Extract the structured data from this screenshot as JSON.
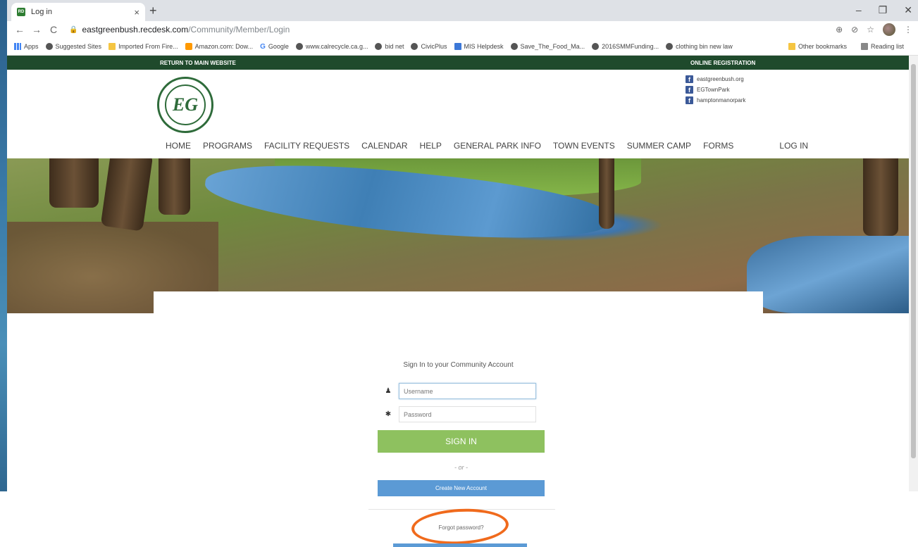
{
  "browser": {
    "tab_title": "Log in",
    "tab_favicon_text": "RD",
    "new_tab": "+",
    "tab_close": "×",
    "url_host": "eastgreenbush.recdesk.com",
    "url_path": "/Community/Member/Login",
    "controls": {
      "minimize": "–",
      "restore": "❐",
      "close": "✕"
    },
    "nav": {
      "back": "←",
      "forward": "→",
      "reload": "C"
    }
  },
  "bookmarks": {
    "items": [
      {
        "label": "Apps",
        "icon": "apps-icon"
      },
      {
        "label": "Suggested Sites",
        "icon": "globe-icon"
      },
      {
        "label": "Imported From Fire...",
        "icon": "folder-icon"
      },
      {
        "label": "Amazon.com: Dow...",
        "icon": "amazon-icon"
      },
      {
        "label": "Google",
        "icon": "google-icon"
      },
      {
        "label": "www.calrecycle.ca.g...",
        "icon": "globe-icon"
      },
      {
        "label": "bid net",
        "icon": "globe-icon"
      },
      {
        "label": "CivicPlus",
        "icon": "globe-icon"
      },
      {
        "label": "MIS Helpdesk",
        "icon": "mis-icon"
      },
      {
        "label": "Save_The_Food_Ma...",
        "icon": "globe-icon"
      },
      {
        "label": "2016SMMFunding...",
        "icon": "globe-icon"
      },
      {
        "label": "clothing bin new law",
        "icon": "globe-icon"
      }
    ],
    "other": "Other bookmarks",
    "reading": "Reading list"
  },
  "site": {
    "topbar": {
      "return": "RETURN TO MAIN WEBSITE",
      "online": "ONLINE REGISTRATION"
    },
    "logo_text": "EG",
    "social": [
      "eastgreenbush.org",
      "EGTownPark",
      "hamptonmanorpark"
    ],
    "nav": [
      "HOME",
      "PROGRAMS",
      "FACILITY REQUESTS",
      "CALENDAR",
      "HELP",
      "GENERAL PARK INFO",
      "TOWN EVENTS",
      "SUMMER CAMP",
      "FORMS"
    ],
    "nav_login": "LOG IN",
    "login": {
      "title": "Sign In to your Community Account",
      "username_placeholder": "Username",
      "password_placeholder": "Password",
      "signin": "SIGN IN",
      "or": "- or -",
      "create": "Create New Account",
      "forgot": "Forgot password?"
    }
  },
  "colors": {
    "site_green": "#1f4a2c",
    "signin_green": "#8ec15f",
    "create_blue": "#5b9ad5",
    "annotation_orange": "#f06a1c"
  }
}
